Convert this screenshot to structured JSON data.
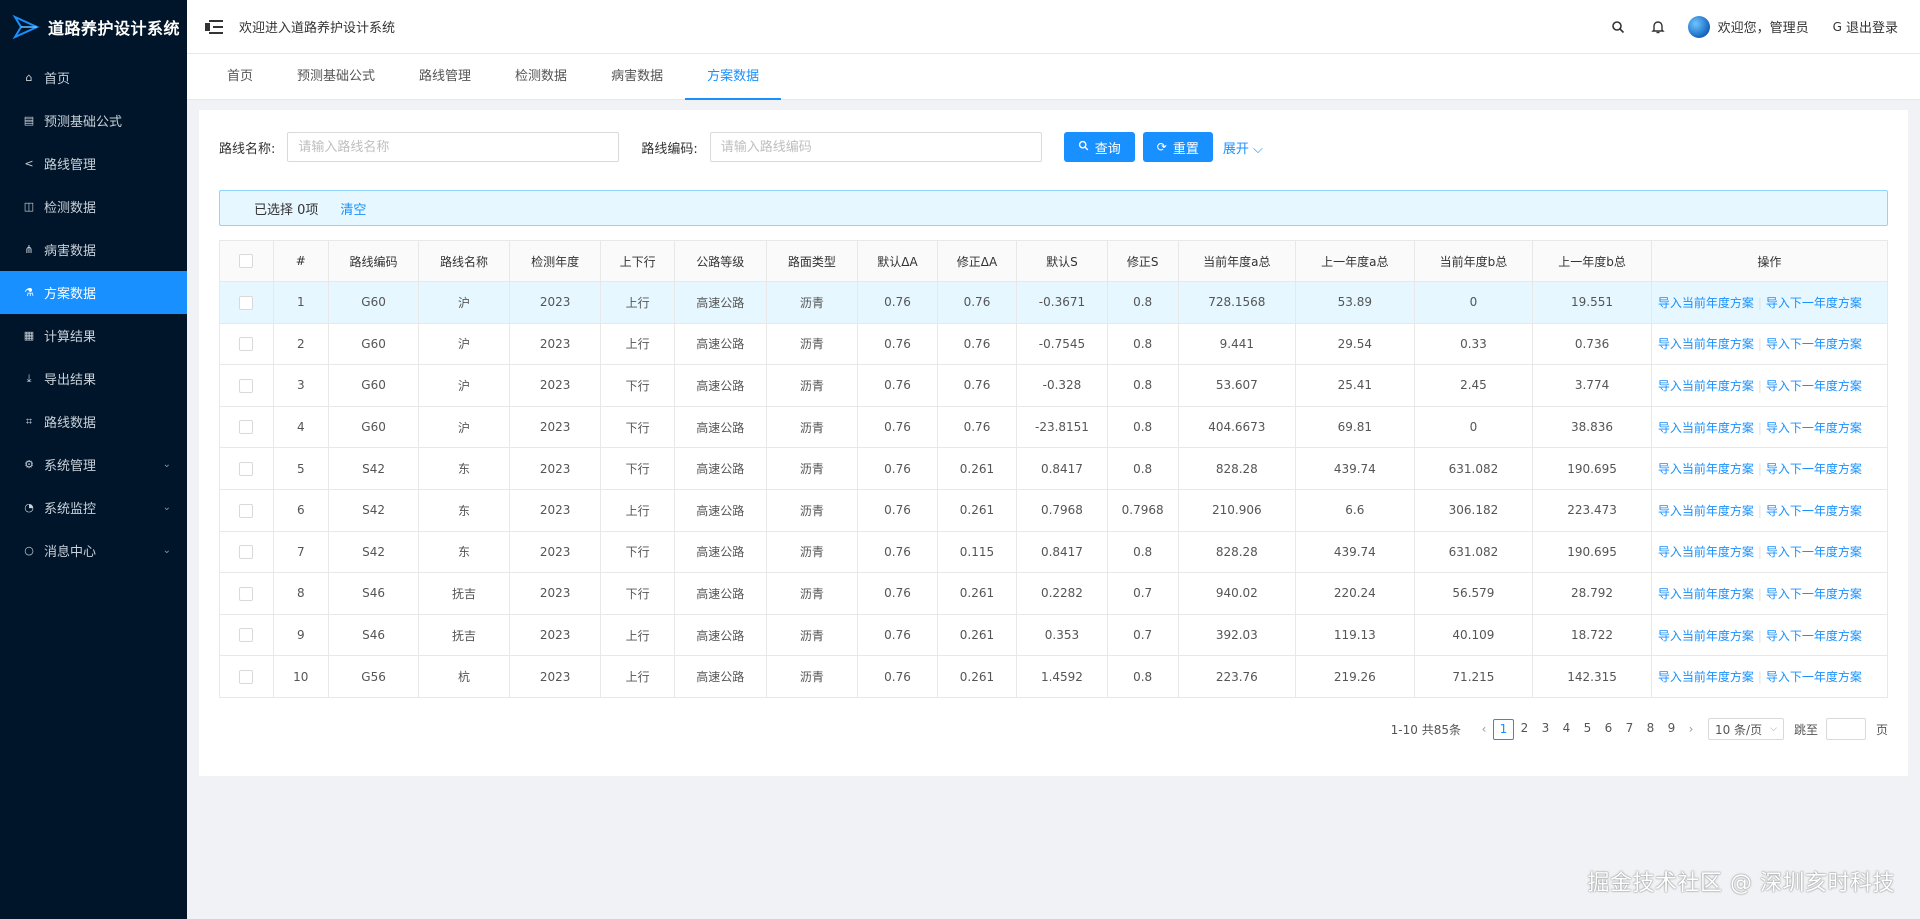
{
  "app": {
    "title": "道路养护设计系统"
  },
  "sidebar": {
    "items": [
      {
        "label": "首页",
        "icon": "home-icon",
        "glyph": "⌂",
        "active": false,
        "submenu": false
      },
      {
        "label": "预测基础公式",
        "icon": "table-icon",
        "glyph": "▤",
        "active": false,
        "submenu": false
      },
      {
        "label": "路线管理",
        "icon": "share-icon",
        "glyph": "<",
        "active": false,
        "submenu": false
      },
      {
        "label": "检测数据",
        "icon": "database-icon",
        "glyph": "◫",
        "active": false,
        "submenu": false
      },
      {
        "label": "病害数据",
        "icon": "cluster-icon",
        "glyph": "⋔",
        "active": false,
        "submenu": false
      },
      {
        "label": "方案数据",
        "icon": "flask-icon",
        "glyph": "⚗",
        "active": true,
        "submenu": false
      },
      {
        "label": "计算结果",
        "icon": "calculator-icon",
        "glyph": "▦",
        "active": false,
        "submenu": false
      },
      {
        "label": "导出结果",
        "icon": "download-icon",
        "glyph": "⤓",
        "active": false,
        "submenu": false
      },
      {
        "label": "路线数据",
        "icon": "nodes-icon",
        "glyph": "⌗",
        "active": false,
        "submenu": false
      },
      {
        "label": "系统管理",
        "icon": "gear-icon",
        "glyph": "⚙",
        "active": false,
        "submenu": true
      },
      {
        "label": "系统监控",
        "icon": "monitor-icon",
        "glyph": "◔",
        "active": false,
        "submenu": true
      },
      {
        "label": "消息中心",
        "icon": "message-icon",
        "glyph": "○",
        "active": false,
        "submenu": true
      }
    ]
  },
  "header": {
    "welcome": "欢迎进入道路养护设计系统",
    "user_greeting": "欢迎您，管理员",
    "logout_label": "退出登录"
  },
  "tabs": [
    {
      "label": "首页",
      "active": false
    },
    {
      "label": "预测基础公式",
      "active": false
    },
    {
      "label": "路线管理",
      "active": false
    },
    {
      "label": "检测数据",
      "active": false
    },
    {
      "label": "病害数据",
      "active": false
    },
    {
      "label": "方案数据",
      "active": true
    }
  ],
  "filters": {
    "route_name_label": "路线名称:",
    "route_name_placeholder": "请输入路线名称",
    "route_code_label": "路线编码:",
    "route_code_placeholder": "请输入路线编码",
    "query_label": "查询",
    "reset_label": "重置",
    "expand_label": "展开"
  },
  "selection": {
    "text": "已选择 0项",
    "clear_label": "清空"
  },
  "table": {
    "columns": [
      "#",
      "路线编码",
      "路线名称",
      "检测年度",
      "上下行",
      "公路等级",
      "路面类型",
      "默认ΔA",
      "修正ΔA",
      "默认S",
      "修正S",
      "当前年度a总",
      "上一年度a总",
      "当前年度b总",
      "上一年度b总",
      "操作"
    ],
    "op_current": "导入当前年度方案",
    "op_next": "导入下一年度方案",
    "rows": [
      [
        "1",
        "G60",
        "沪",
        "2023",
        "上行",
        "高速公路",
        "沥青",
        "0.76",
        "0.76",
        "-0.3671",
        "0.8",
        "728.1568",
        "53.89",
        "0",
        "19.551"
      ],
      [
        "2",
        "G60",
        "沪",
        "2023",
        "上行",
        "高速公路",
        "沥青",
        "0.76",
        "0.76",
        "-0.7545",
        "0.8",
        "9.441",
        "29.54",
        "0.33",
        "0.736"
      ],
      [
        "3",
        "G60",
        "沪",
        "2023",
        "下行",
        "高速公路",
        "沥青",
        "0.76",
        "0.76",
        "-0.328",
        "0.8",
        "53.607",
        "25.41",
        "2.45",
        "3.774"
      ],
      [
        "4",
        "G60",
        "沪",
        "2023",
        "下行",
        "高速公路",
        "沥青",
        "0.76",
        "0.76",
        "-23.8151",
        "0.8",
        "404.6673",
        "69.81",
        "0",
        "38.836"
      ],
      [
        "5",
        "S42",
        "东",
        "2023",
        "下行",
        "高速公路",
        "沥青",
        "0.76",
        "0.261",
        "0.8417",
        "0.8",
        "828.28",
        "439.74",
        "631.082",
        "190.695"
      ],
      [
        "6",
        "S42",
        "东",
        "2023",
        "上行",
        "高速公路",
        "沥青",
        "0.76",
        "0.261",
        "0.7968",
        "0.7968",
        "210.906",
        "6.6",
        "306.182",
        "223.473"
      ],
      [
        "7",
        "S42",
        "东",
        "2023",
        "下行",
        "高速公路",
        "沥青",
        "0.76",
        "0.115",
        "0.8417",
        "0.8",
        "828.28",
        "439.74",
        "631.082",
        "190.695"
      ],
      [
        "8",
        "S46",
        "抚吉",
        "2023",
        "下行",
        "高速公路",
        "沥青",
        "0.76",
        "0.261",
        "0.2282",
        "0.7",
        "940.02",
        "220.24",
        "56.579",
        "28.792"
      ],
      [
        "9",
        "S46",
        "抚吉",
        "2023",
        "上行",
        "高速公路",
        "沥青",
        "0.76",
        "0.261",
        "0.353",
        "0.7",
        "392.03",
        "119.13",
        "40.109",
        "18.722"
      ],
      [
        "10",
        "G56",
        "杭",
        "2023",
        "上行",
        "高速公路",
        "沥青",
        "0.76",
        "0.261",
        "1.4592",
        "0.8",
        "223.76",
        "219.26",
        "71.215",
        "142.315"
      ]
    ]
  },
  "pagination": {
    "total_text": "1-10 共85条",
    "pages": [
      "1",
      "2",
      "3",
      "4",
      "5",
      "6",
      "7",
      "8",
      "9"
    ],
    "current": "1",
    "page_size": "10 条/页",
    "jump_label": "跳至",
    "page_suffix": "页"
  },
  "watermark": "掘金技术社区 @ 深圳亥时科技",
  "colors": {
    "sidebar_bg": "#001529",
    "accent": "#1890ff",
    "row_highlight": "#e6f7ff"
  }
}
